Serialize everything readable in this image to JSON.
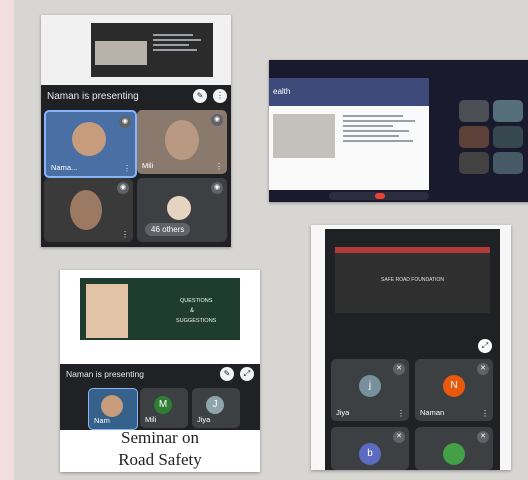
{
  "top_left": {
    "presenting_label": "Naman is presenting",
    "tiles": [
      {
        "name": "Nama..."
      },
      {
        "name": "Mili"
      },
      {
        "name": ""
      },
      {
        "name": "46 others"
      }
    ]
  },
  "top_right": {
    "slide_heading": "ealth"
  },
  "bottom_left": {
    "slide_text_1": "QUESTIONS",
    "slide_text_2": "&",
    "slide_text_3": "SUGGESTIONS",
    "presenting_label": "Naman is presenting",
    "tiles": [
      {
        "name": "Nam",
        "initial": ""
      },
      {
        "name": "Mili",
        "initial": "M"
      },
      {
        "name": "Jiya",
        "initial": "J"
      }
    ],
    "caption_line1": "Seminar on",
    "caption_line2": "Road Safety"
  },
  "bottom_right": {
    "slide_title": "SAFE ROAD FOUNDATION",
    "tiles": [
      {
        "name": "Jiya",
        "initial": "j",
        "color": "#78909c"
      },
      {
        "name": "Naman",
        "initial": "N",
        "color": "#e8590c"
      },
      {
        "name": "",
        "initial": "b",
        "color": "#5c6bc0"
      },
      {
        "name": "",
        "initial": "",
        "color": "#43a047"
      }
    ]
  },
  "colors": {
    "background": "#d8d6d3",
    "meet_dark": "#202124",
    "tile_gray": "#3c4043",
    "accent_blue": "#1a73e8",
    "avatar_green": "#2e7d32"
  }
}
